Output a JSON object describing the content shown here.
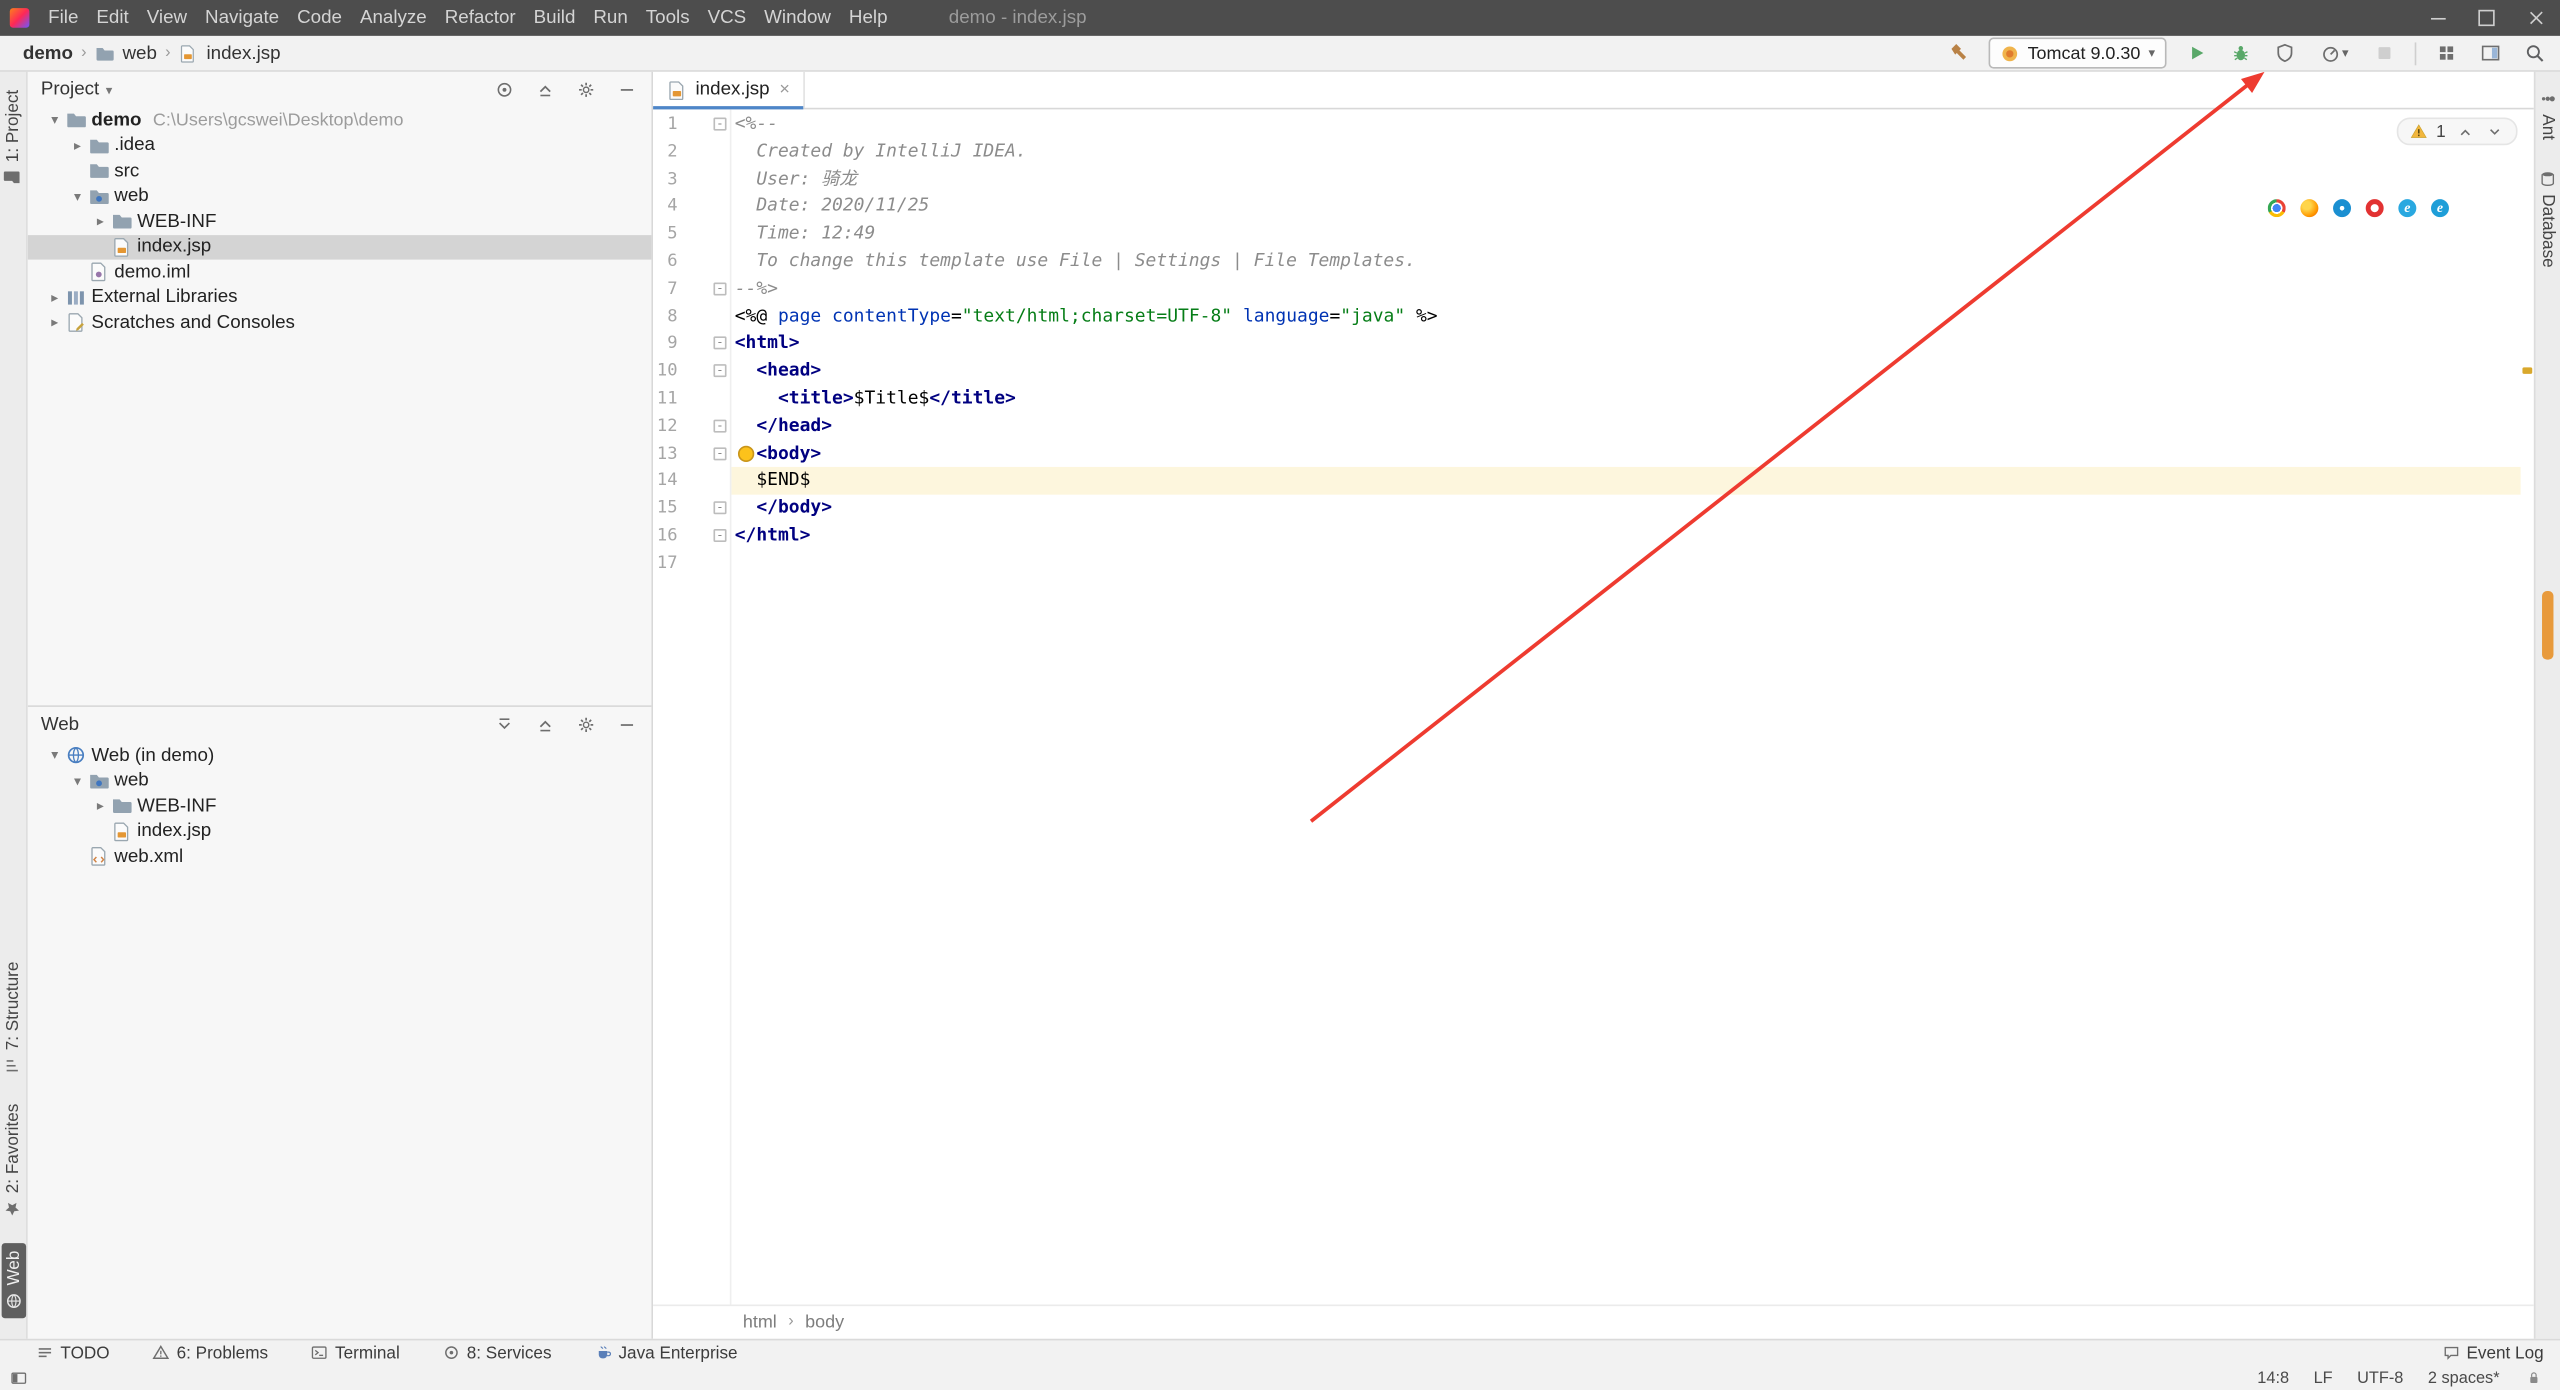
{
  "titlebar": {
    "title": "demo - index.jsp",
    "menus": [
      "File",
      "Edit",
      "View",
      "Navigate",
      "Code",
      "Analyze",
      "Refactor",
      "Build",
      "Run",
      "Tools",
      "VCS",
      "Window",
      "Help"
    ]
  },
  "navbar": {
    "breadcrumbs": [
      {
        "label": "demo",
        "bold": true
      },
      {
        "label": "web",
        "icon": "folder"
      },
      {
        "label": "index.jsp",
        "icon": "jsp"
      }
    ],
    "run_config": "Tomcat 9.0.30",
    "run_actions": [
      "run",
      "debug",
      "coverage",
      "profiler",
      "stop"
    ],
    "right_actions": [
      "grid",
      "layout",
      "search"
    ]
  },
  "left_stripe": {
    "top": [
      {
        "label": "1: Project",
        "icon": "project"
      }
    ],
    "bottom": [
      {
        "label": "7: Structure",
        "icon": "structure"
      },
      {
        "label": "2: Favorites",
        "icon": "favorites"
      },
      {
        "label": "Web",
        "icon": "web-globe",
        "active": true
      }
    ]
  },
  "right_stripe": {
    "top": [
      {
        "label": "Ant",
        "icon": "ant"
      },
      {
        "label": "Database",
        "icon": "database"
      }
    ]
  },
  "project_panel": {
    "title": "Project",
    "actions": [
      {
        "icon": "target",
        "name": "select-opened-file"
      },
      {
        "icon": "collapse",
        "name": "collapse-all"
      },
      {
        "icon": "gear",
        "name": "settings"
      },
      {
        "icon": "minus",
        "name": "hide"
      }
    ],
    "tree": [
      {
        "label": "demo",
        "sublabel": "C:\\Users\\gcswei\\Desktop\\demo",
        "depth": 1,
        "arrow": "down",
        "icon": "folder",
        "bold": true
      },
      {
        "label": ".idea",
        "depth": 2,
        "arrow": "right",
        "icon": "folder"
      },
      {
        "label": "src",
        "depth": 2,
        "icon": "folder"
      },
      {
        "label": "web",
        "depth": 2,
        "arrow": "down",
        "icon": "folder-web"
      },
      {
        "label": "WEB-INF",
        "depth": 3,
        "arrow": "right",
        "icon": "folder"
      },
      {
        "label": "index.jsp",
        "depth": 3,
        "icon": "jsp",
        "selected": true
      },
      {
        "label": "demo.iml",
        "depth": 2,
        "icon": "iml"
      },
      {
        "label": "External Libraries",
        "depth": 1,
        "arrow": "right",
        "icon": "libraries"
      },
      {
        "label": "Scratches and Consoles",
        "depth": 1,
        "arrow": "right",
        "icon": "scratches"
      }
    ]
  },
  "web_panel": {
    "title": "Web",
    "actions": [
      {
        "icon": "expand",
        "name": "expand-all"
      },
      {
        "icon": "collapse",
        "name": "collapse-all"
      },
      {
        "icon": "gear",
        "name": "settings"
      },
      {
        "icon": "minus",
        "name": "hide"
      }
    ],
    "tree": [
      {
        "label": "Web (in demo)",
        "depth": 1,
        "arrow": "down",
        "icon": "web-facet"
      },
      {
        "label": "web",
        "depth": 2,
        "arrow": "down",
        "icon": "folder-web"
      },
      {
        "label": "WEB-INF",
        "depth": 3,
        "arrow": "right",
        "icon": "folder"
      },
      {
        "label": "index.jsp",
        "depth": 3,
        "icon": "jsp"
      },
      {
        "label": "web.xml",
        "depth": 2,
        "icon": "xml"
      }
    ]
  },
  "editor": {
    "tab": "index.jsp",
    "inspection_count": "1",
    "breadcrumbs": [
      "html",
      "body"
    ],
    "browsers": [
      "chrome",
      "firefox",
      "safari",
      "opera",
      "ie",
      "edge"
    ],
    "code": [
      {
        "n": 1,
        "fold": "open",
        "tokens": [
          {
            "s": "comment",
            "t": "<%--"
          }
        ]
      },
      {
        "n": 2,
        "tokens": [
          {
            "s": "comment",
            "t": "  Created by IntelliJ IDEA."
          }
        ]
      },
      {
        "n": 3,
        "tokens": [
          {
            "s": "comment",
            "t": "  User: 骑龙"
          }
        ]
      },
      {
        "n": 4,
        "tokens": [
          {
            "s": "comment",
            "t": "  Date: 2020/11/25"
          }
        ]
      },
      {
        "n": 5,
        "tokens": [
          {
            "s": "comment",
            "t": "  Time: 12:49"
          }
        ]
      },
      {
        "n": 6,
        "tokens": [
          {
            "s": "comment",
            "t": "  To change this template use File | Settings | File Templates."
          }
        ]
      },
      {
        "n": 7,
        "fold": "close",
        "tokens": [
          {
            "s": "comment",
            "t": "--%>"
          }
        ]
      },
      {
        "n": 8,
        "tokens": [
          {
            "s": "plain",
            "t": "<%@ "
          },
          {
            "s": "keyword",
            "t": "page"
          },
          {
            "s": "plain",
            "t": " "
          },
          {
            "s": "attr",
            "t": "contentType"
          },
          {
            "s": "plain",
            "t": "="
          },
          {
            "s": "string",
            "t": "\"text/html;charset=UTF-8\""
          },
          {
            "s": "plain",
            "t": " "
          },
          {
            "s": "attr",
            "t": "language"
          },
          {
            "s": "plain",
            "t": "="
          },
          {
            "s": "string",
            "t": "\"java\""
          },
          {
            "s": "plain",
            "t": " %>"
          }
        ]
      },
      {
        "n": 9,
        "fold": "open",
        "tokens": [
          {
            "s": "tag",
            "t": "<html>"
          }
        ]
      },
      {
        "n": 10,
        "fold": "open",
        "tokens": [
          {
            "s": "plain",
            "t": "  "
          },
          {
            "s": "tag",
            "t": "<head>"
          }
        ]
      },
      {
        "n": 11,
        "tokens": [
          {
            "s": "plain",
            "t": "    "
          },
          {
            "s": "tag",
            "t": "<title>"
          },
          {
            "s": "plain",
            "t": "$Title$"
          },
          {
            "s": "tag",
            "t": "</title>"
          }
        ]
      },
      {
        "n": 12,
        "fold": "close",
        "tokens": [
          {
            "s": "plain",
            "t": "  "
          },
          {
            "s": "tag",
            "t": "</head>"
          }
        ]
      },
      {
        "n": 13,
        "fold": "open",
        "bulb": true,
        "tokens": [
          {
            "s": "plain",
            "t": "  "
          },
          {
            "s": "tag",
            "t": "<body>"
          }
        ]
      },
      {
        "n": 14,
        "caret": true,
        "tokens": [
          {
            "s": "plain",
            "t": "  $END$"
          }
        ]
      },
      {
        "n": 15,
        "fold": "close",
        "tokens": [
          {
            "s": "plain",
            "t": "  "
          },
          {
            "s": "tag",
            "t": "</body>"
          }
        ]
      },
      {
        "n": 16,
        "fold": "close",
        "tokens": [
          {
            "s": "tag",
            "t": "</html>"
          }
        ]
      },
      {
        "n": 17,
        "tokens": []
      }
    ]
  },
  "bottom_bar": {
    "left": [
      {
        "label": "TODO",
        "icon": "todo"
      },
      {
        "label": "6: Problems",
        "icon": "problems"
      },
      {
        "label": "Terminal",
        "icon": "terminal"
      },
      {
        "label": "8: Services",
        "icon": "services"
      },
      {
        "label": "Java Enterprise",
        "icon": "javaee"
      }
    ],
    "right": [
      {
        "label": "Event Log",
        "icon": "eventlog"
      }
    ]
  },
  "status_bar": {
    "items": [
      "14:8",
      "LF",
      "UTF-8",
      "2 spaces*"
    ]
  },
  "colors": {
    "annotation_arrow": "#ee3b30",
    "caret_line": "#fdf6dd",
    "selection_inactive": "#d4d4d4",
    "run_green": "#59a869",
    "warning_yellow": "#f2b63d"
  }
}
